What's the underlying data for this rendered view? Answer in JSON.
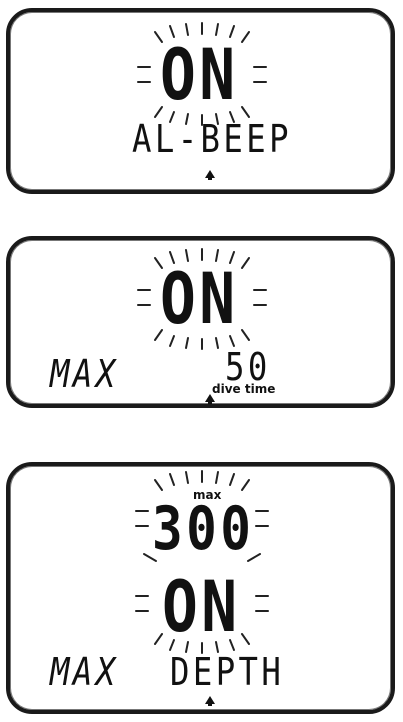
{
  "screens": [
    {
      "main_value": "ON",
      "bottom_label": "AL-BEEP"
    },
    {
      "main_value": "ON",
      "bottom_left": "MAX",
      "bottom_right_value": "50",
      "bottom_right_caption": "dive time"
    },
    {
      "top_small_label": "max",
      "top_value": "300",
      "main_value": "ON",
      "bottom_left": "MAX",
      "bottom_label": "DEPTH"
    }
  ],
  "icons": {
    "flash": "flashing-rays-icon",
    "alarm": "alarm-bell-icon"
  }
}
